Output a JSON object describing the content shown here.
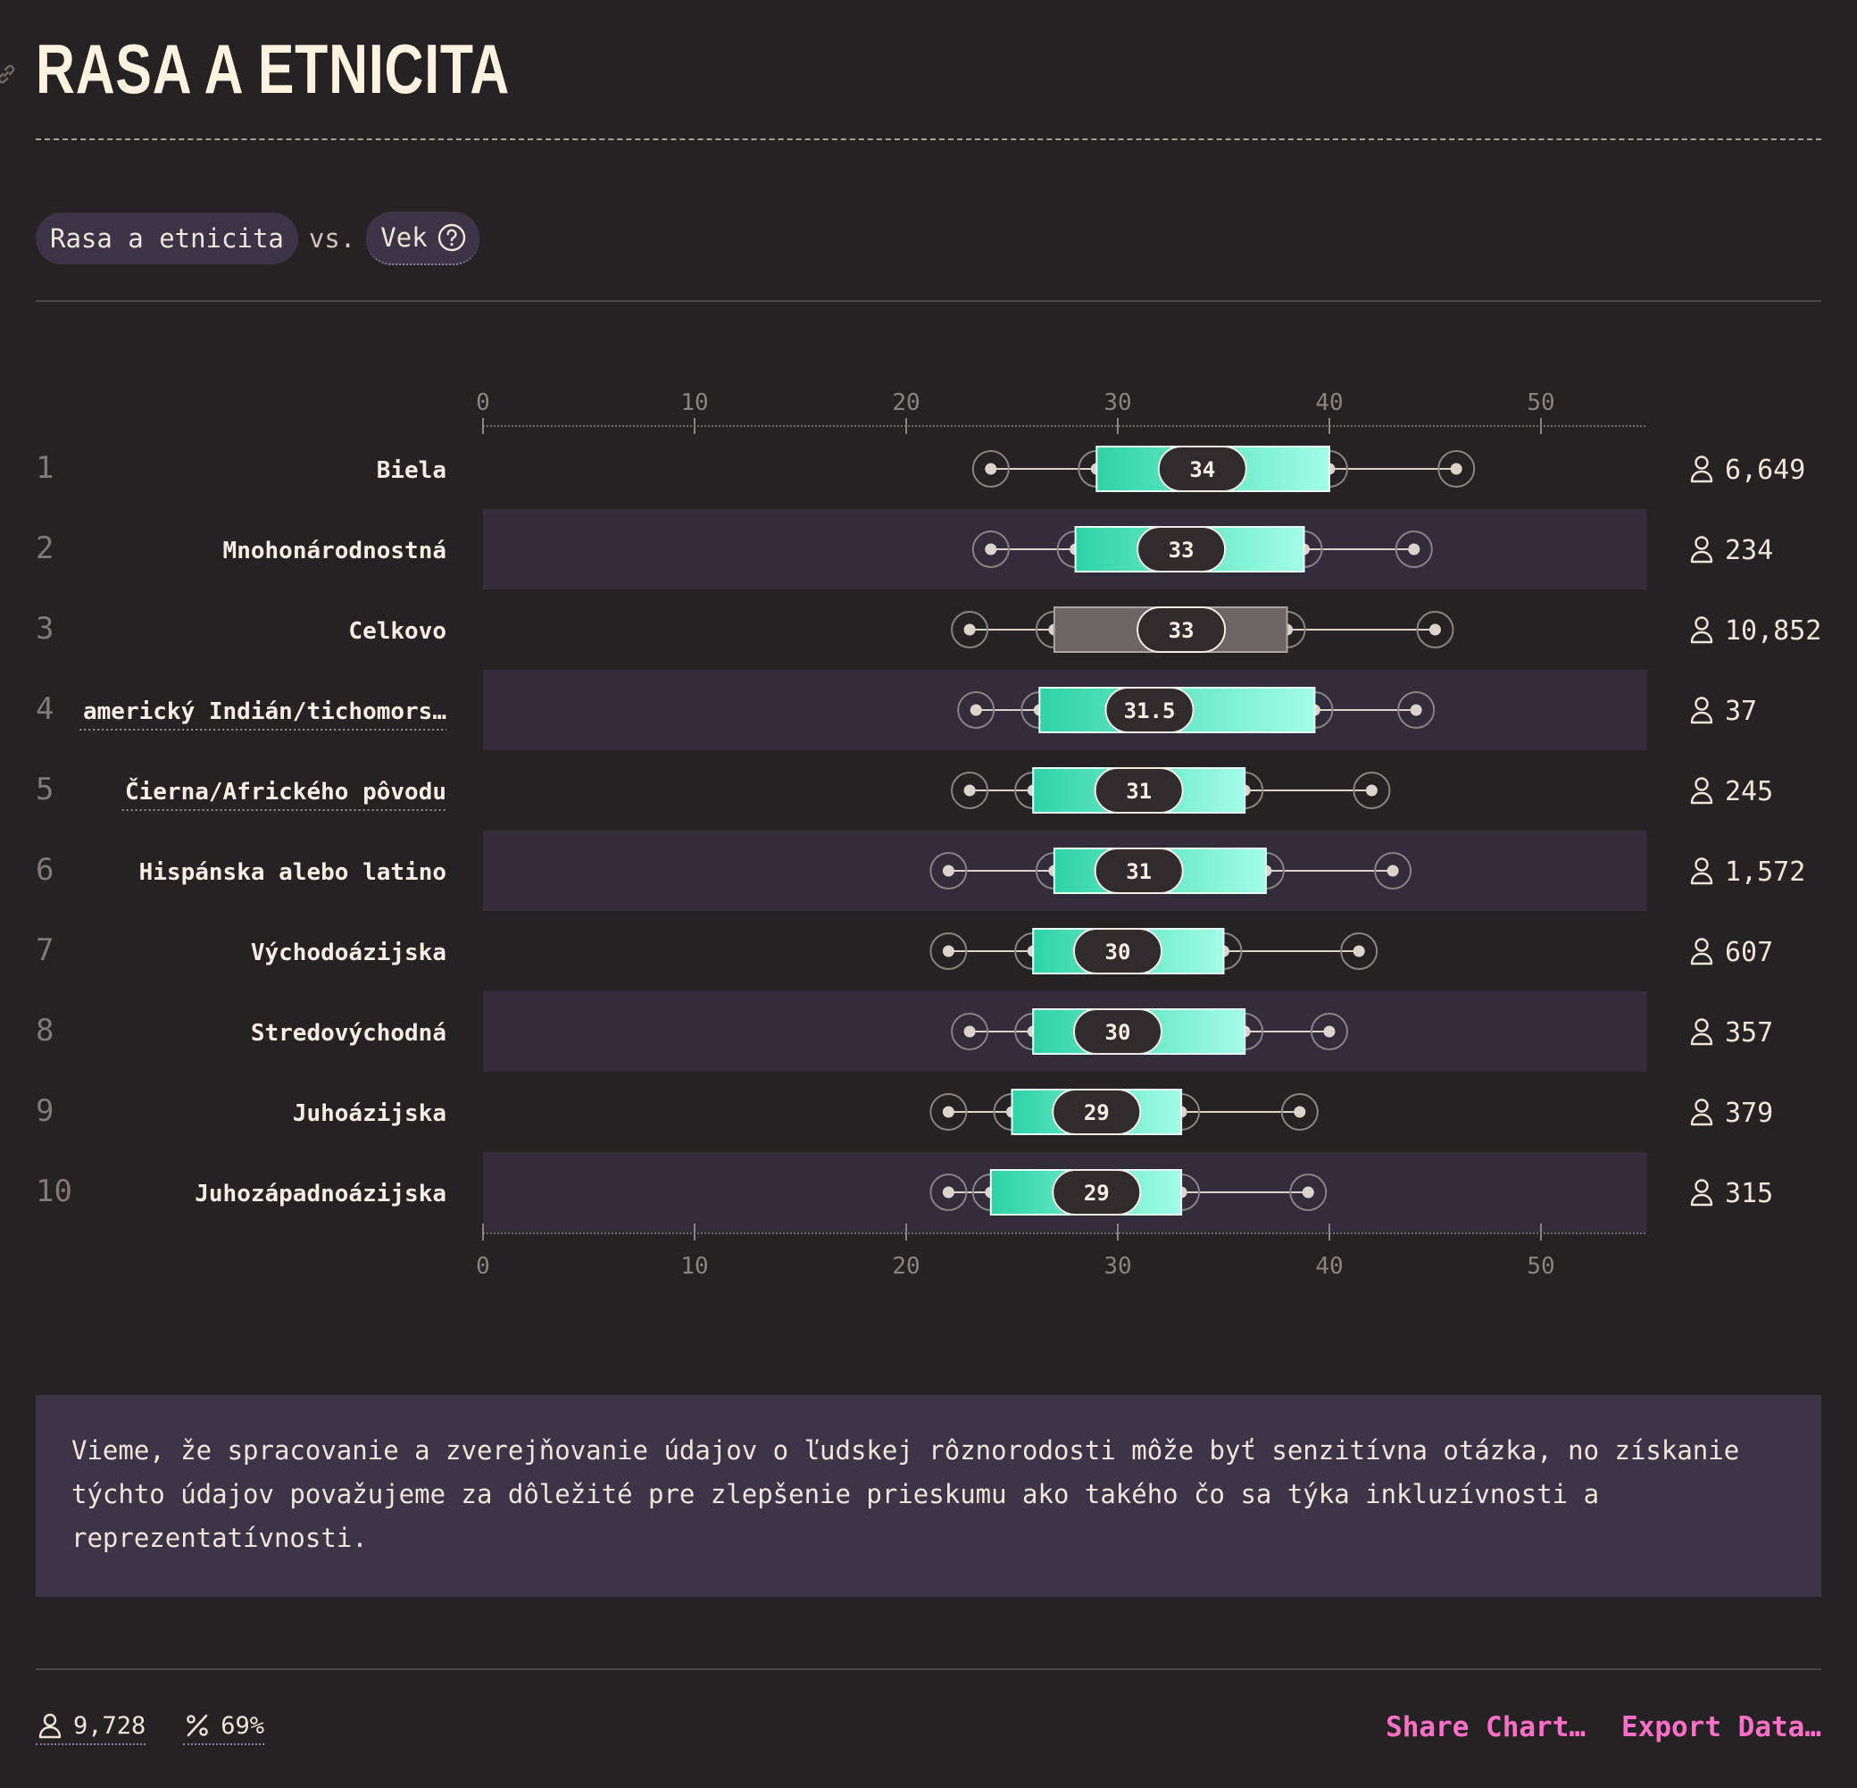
{
  "header": {
    "title": "RASA A ETNICITA"
  },
  "filters": {
    "primary": "Rasa a etnicita",
    "vs": "vs.",
    "secondary": "Vek"
  },
  "note": "Vieme, že spracovanie a zverejňovanie údajov o ľudskej rôznorodosti môže byť senzitívna otázka, no získanie týchto údajov považujeme za dôležité pre zlepšenie prieskumu ako takého čo sa týka inkluzívnosti a reprezentatívnosti.",
  "footer": {
    "respondents": "9,728",
    "percent": "69%",
    "share_label": "Share Chart…",
    "export_label": "Export Data…"
  },
  "colors": {
    "accent": "#2ed3a7",
    "accent_light": "#a2fde6",
    "overall": "#6b6666",
    "band": "#322c3b",
    "link": "#ff6fc8"
  },
  "chart_data": {
    "type": "box",
    "xlim": [
      0,
      55
    ],
    "xticks": [
      0,
      10,
      20,
      30,
      40,
      50
    ],
    "rows": [
      {
        "rank": "1",
        "label": "Biela",
        "p10": 24,
        "q1": 29,
        "median": 34,
        "q3": 40,
        "p90": 46,
        "count": "6,649",
        "highlight": false,
        "truncated": false
      },
      {
        "rank": "2",
        "label": "Mnohonárodnostná",
        "p10": 24,
        "q1": 28,
        "median": 33,
        "q3": 38.8,
        "p90": 44,
        "count": "234",
        "highlight": false,
        "truncated": false
      },
      {
        "rank": "3",
        "label": "Celkovo",
        "p10": 23,
        "q1": 27,
        "median": 33,
        "q3": 38,
        "p90": 45,
        "count": "10,852",
        "highlight": true,
        "truncated": false
      },
      {
        "rank": "4",
        "label": "americký Indián/tichomors…",
        "p10": 23.3,
        "q1": 26.3,
        "median": 31.5,
        "q3": 39.3,
        "p90": 44.1,
        "count": "37",
        "highlight": false,
        "truncated": true
      },
      {
        "rank": "5",
        "label": "Čierna/Afrického pôvodu",
        "p10": 23,
        "q1": 26,
        "median": 31,
        "q3": 36,
        "p90": 42,
        "count": "245",
        "highlight": false,
        "truncated": true
      },
      {
        "rank": "6",
        "label": "Hispánska alebo latino",
        "p10": 22,
        "q1": 27,
        "median": 31,
        "q3": 37,
        "p90": 43,
        "count": "1,572",
        "highlight": false,
        "truncated": false
      },
      {
        "rank": "7",
        "label": "Východoázijska",
        "p10": 22,
        "q1": 26,
        "median": 30,
        "q3": 35,
        "p90": 41.4,
        "count": "607",
        "highlight": false,
        "truncated": false
      },
      {
        "rank": "8",
        "label": "Stredovýchodná",
        "p10": 23,
        "q1": 26,
        "median": 30,
        "q3": 36,
        "p90": 40,
        "count": "357",
        "highlight": false,
        "truncated": false
      },
      {
        "rank": "9",
        "label": "Juhoázijska",
        "p10": 22,
        "q1": 25,
        "median": 29,
        "q3": 33,
        "p90": 38.6,
        "count": "379",
        "highlight": false,
        "truncated": false
      },
      {
        "rank": "10",
        "label": "Juhozápadnoázijska",
        "p10": 22,
        "q1": 24,
        "median": 29,
        "q3": 33,
        "p90": 39,
        "count": "315",
        "highlight": false,
        "truncated": false
      }
    ]
  }
}
